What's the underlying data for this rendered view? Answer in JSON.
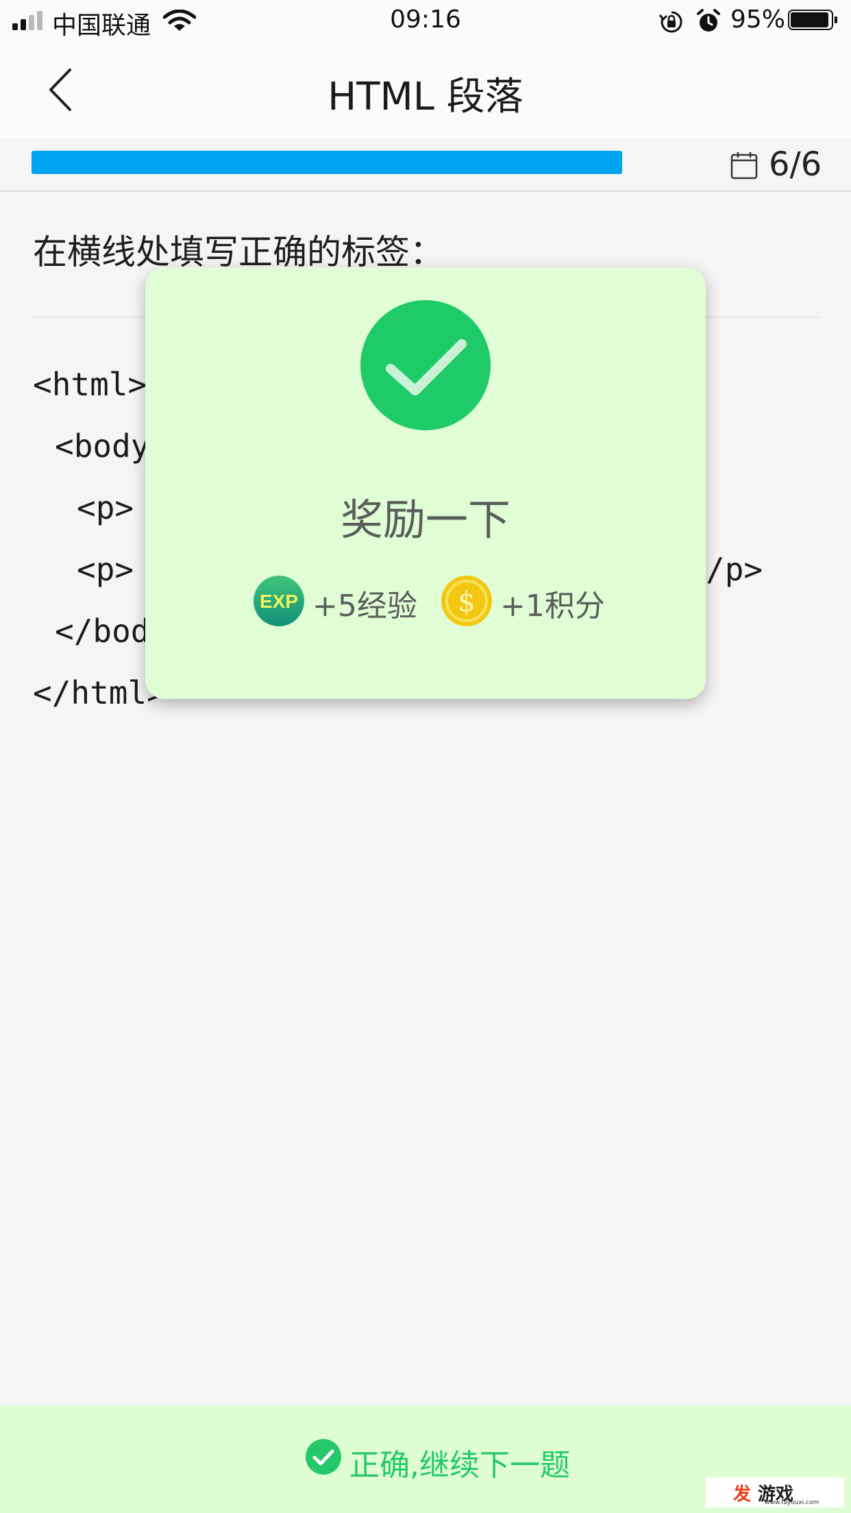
{
  "status_bar": {
    "carrier": "中国联通",
    "time": "09:16",
    "battery_percent": "95%",
    "battery_level": 0.95,
    "icons": [
      "signal-icon",
      "wifi-icon",
      "rotation-lock-icon",
      "alarm-icon",
      "battery-icon"
    ]
  },
  "nav": {
    "title": "HTML 段落",
    "back_icon": "chevron-left-icon"
  },
  "progress": {
    "fraction": 1.0,
    "count_label": "6/6",
    "icon": "calendar-icon",
    "fill_color": "#00a4ef"
  },
  "question": {
    "prompt": "在横线处填写正确的标签："
  },
  "code_lines": [
    "<html>",
    "<body",
    "<p>",
    "<p>",
    "/p>",
    "</bod",
    "</html>"
  ],
  "reward_popup": {
    "title": "奖励一下",
    "icon": "checkmark-icon",
    "exp_badge": "EXP",
    "exp_reward": "+5经验",
    "points_reward": "+1积分",
    "accent_color": "#1fcb69",
    "background": "#e0fdd5"
  },
  "bottom_bar": {
    "label": "正确,继续下一题",
    "icon": "check-circle-icon",
    "color": "#24c869"
  },
  "watermark": {
    "brand_hot": "发",
    "brand_name": "游戏",
    "url": "www.fayouxi.com"
  }
}
